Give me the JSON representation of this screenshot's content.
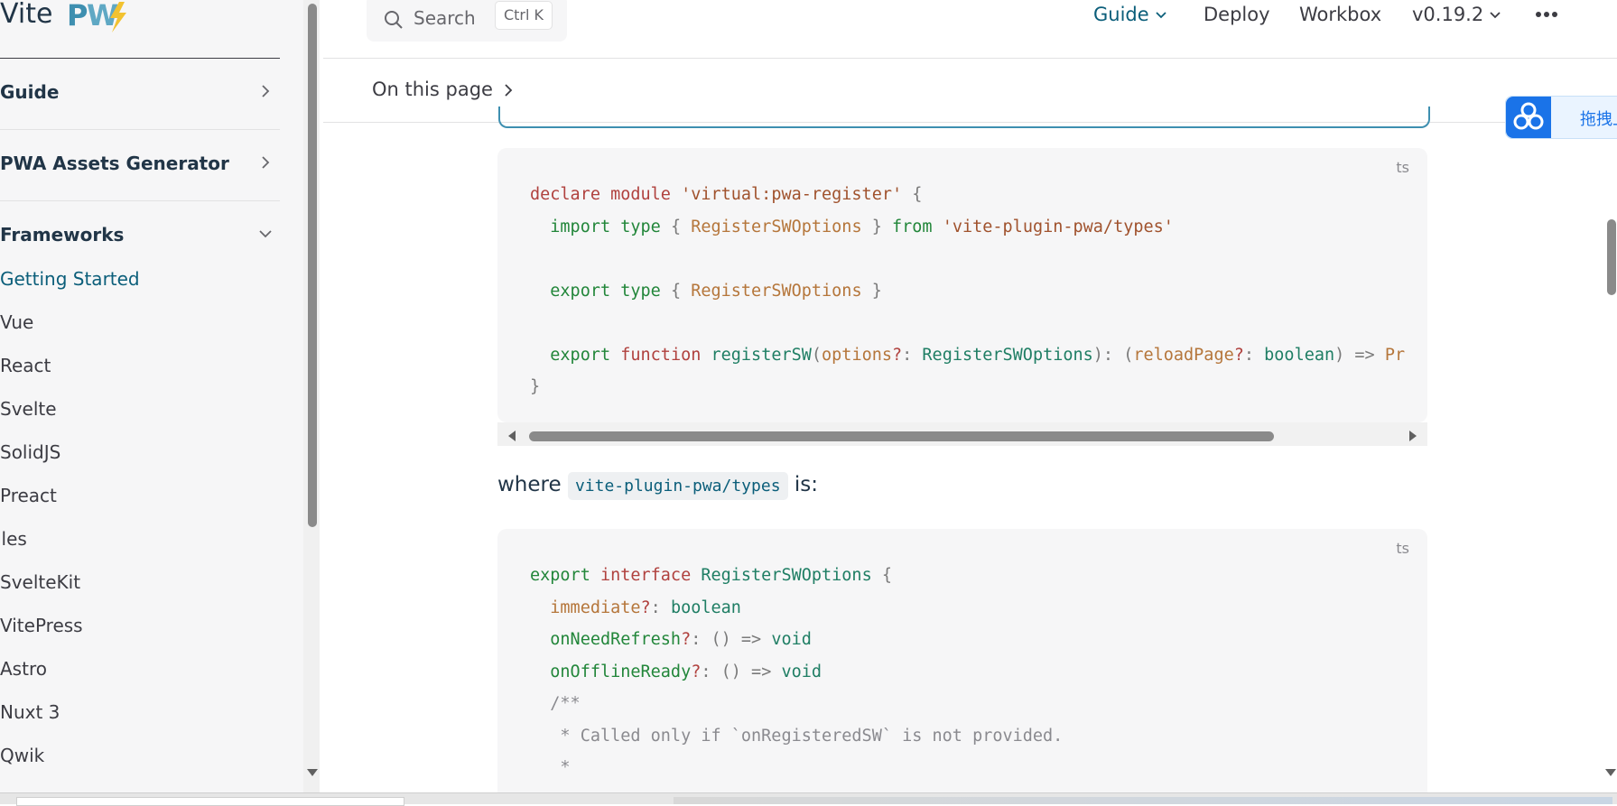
{
  "brand": {
    "name": "Vite",
    "logo_text": "PWA"
  },
  "search": {
    "label": "Search",
    "shortcut": "Ctrl K"
  },
  "nav": {
    "guide": "Guide",
    "deploy": "Deploy",
    "workbox": "Workbox",
    "version": "v0.19.2"
  },
  "local_nav": {
    "label": "On this page"
  },
  "sidebar": {
    "groups": [
      {
        "label": "Guide"
      },
      {
        "label": "PWA Assets Generator"
      },
      {
        "label": "Frameworks"
      }
    ],
    "links": [
      {
        "label": "Getting Started",
        "active": true
      },
      {
        "label": "Vue"
      },
      {
        "label": "React"
      },
      {
        "label": "Svelte"
      },
      {
        "label": "SolidJS"
      },
      {
        "label": "Preact"
      },
      {
        "label": "iles"
      },
      {
        "label": "SvelteKit"
      },
      {
        "label": "VitePress"
      },
      {
        "label": "Astro"
      },
      {
        "label": "Nuxt 3"
      },
      {
        "label": "Qwik"
      }
    ]
  },
  "code1": {
    "lang": "ts",
    "lines": [
      "declare module 'virtual:pwa-register' {",
      "  import type { RegisterSWOptions } from 'vite-plugin-pwa/types'",
      "",
      "  export type { RegisterSWOptions }",
      "",
      "  export function registerSW(options?: RegisterSWOptions): (reloadPage?: boolean) => Pr",
      "}"
    ]
  },
  "prose": {
    "before": "where",
    "code": "vite-plugin-pwa/types",
    "after": "is:"
  },
  "code2": {
    "lang": "ts",
    "lines": [
      "export interface RegisterSWOptions {",
      "  immediate?: boolean",
      "  onNeedRefresh?: () => void",
      "  onOfflineReady?: () => void",
      "  /**",
      "   * Called only if `onRegisteredSW` is not provided.",
      "   *"
    ]
  },
  "widget": {
    "label": "拖拽上传"
  },
  "colors": {
    "accent": "#0b5e7a",
    "brand_blue": "#3e8fb0",
    "sidebar_bg": "#f6f6f7",
    "code_bg": "#f6f6f7"
  }
}
